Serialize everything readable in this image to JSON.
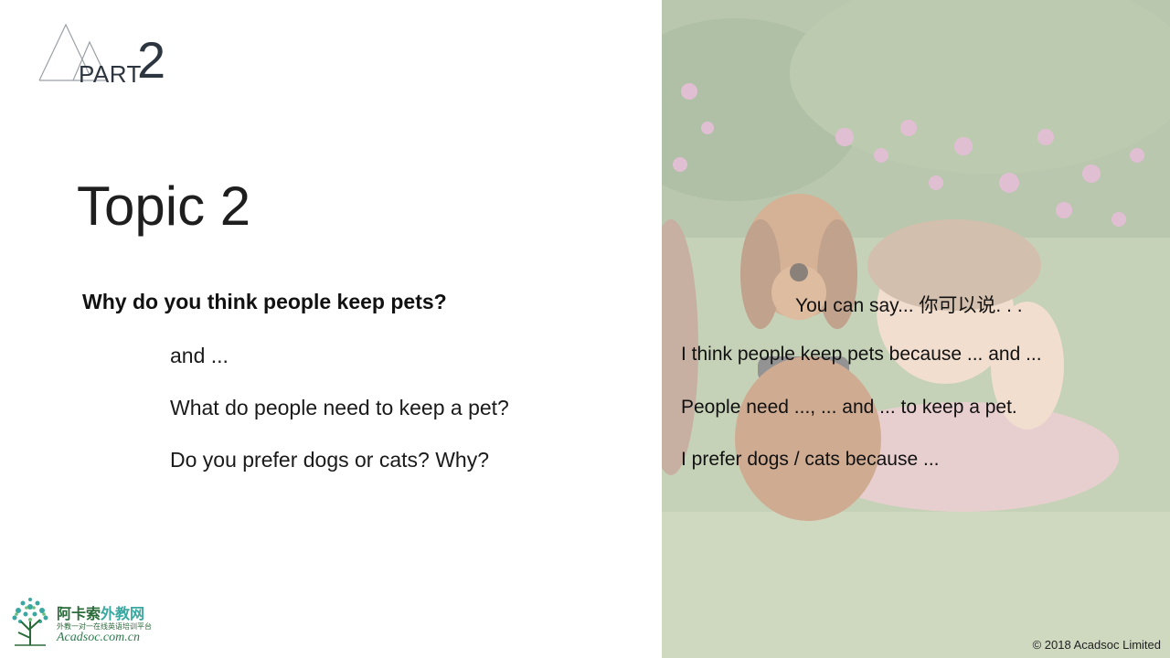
{
  "header": {
    "part_label": "PART",
    "part_number": "2"
  },
  "topic": {
    "title": "Topic 2"
  },
  "questions": {
    "main": "Why do you think people keep pets?",
    "followups": [
      "and ...",
      "What do people need to keep a pet?",
      "Do you prefer dogs or cats? Why?"
    ]
  },
  "you_can_say": {
    "intro": "You can say... 你可以说. . .",
    "lines": [
      "I think people keep pets because ... and ...",
      "People need ..., ... and ... to keep a pet.",
      "I prefer dogs / cats because ..."
    ]
  },
  "footer": {
    "copyright": "© 2018 Acadsoc Limited"
  },
  "logo": {
    "name_part1": "阿卡索",
    "name_part2": "外教网",
    "tagline": "外教一对一在线英语培训平台",
    "url": "Acadsoc.com.cn"
  },
  "colors": {
    "header_text": "#2d3640",
    "logo_green": "#2a6b3a",
    "logo_teal": "#3aa8a0"
  },
  "image": {
    "description_icon": "photo-dog-and-child"
  }
}
